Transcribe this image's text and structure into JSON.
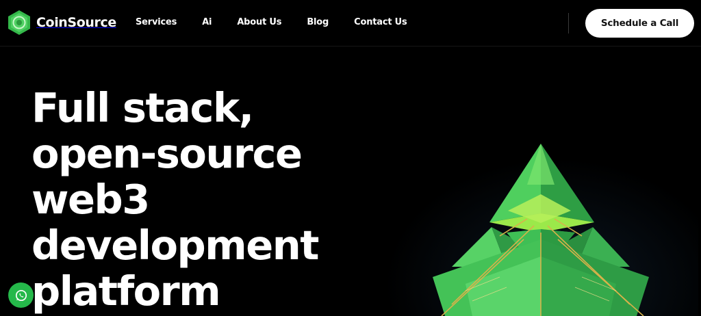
{
  "brand": {
    "name": "CoinSource",
    "accent": "#3fbf4f"
  },
  "nav": {
    "items": [
      {
        "label": "Services"
      },
      {
        "label": "Ai"
      },
      {
        "label": "About Us"
      },
      {
        "label": "Blog"
      },
      {
        "label": "Contact Us"
      }
    ]
  },
  "cta": {
    "label": "Schedule a Call"
  },
  "hero": {
    "lines": [
      "Full stack,",
      "open-source",
      "web3",
      "development",
      "platform"
    ]
  },
  "icons": {
    "logo": "hexagon-coin-logo",
    "whatsapp": "whatsapp-icon",
    "hero_art": "green-crystal-tree"
  }
}
